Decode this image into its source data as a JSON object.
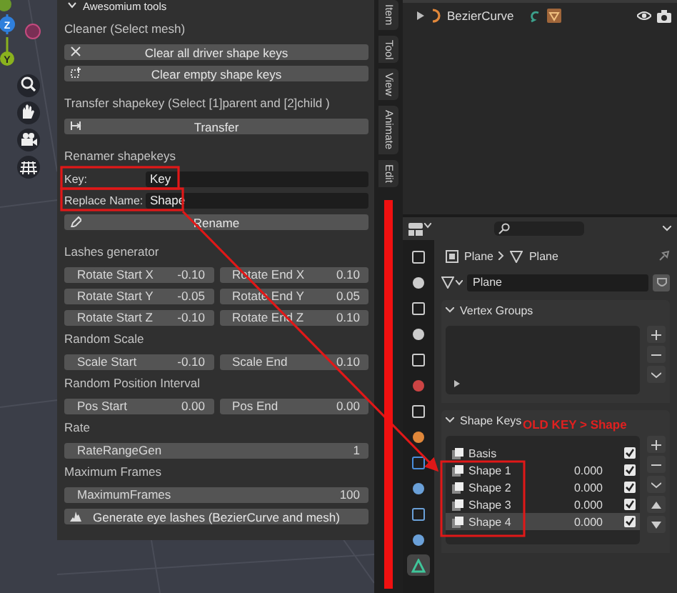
{
  "viewport": {
    "axes": [
      {
        "label": "Z",
        "color": "#2f7fdc"
      },
      {
        "label": "Y",
        "color": "#8ab21e"
      }
    ]
  },
  "tool_panel": {
    "title": "Awesomium tools",
    "sections": [
      {
        "label": "Cleaner (Select mesh)",
        "rows": [
          {
            "kind": "button",
            "label": "Clear all driver shape keys"
          },
          {
            "kind": "button",
            "label": "Clear empty shape keys"
          }
        ]
      },
      {
        "label": "Transfer shapekey (Select [1]parent and [2]child )",
        "rows": [
          {
            "kind": "button",
            "label": "Transfer"
          }
        ]
      },
      {
        "label": "Renamer shapekeys",
        "rows": [
          {
            "kind": "text_field",
            "label": "Key:",
            "value": "Key"
          },
          {
            "kind": "text_field",
            "label": "Replace Name:",
            "value": "Shape"
          },
          {
            "kind": "button",
            "label": "Rename"
          }
        ]
      },
      {
        "label": "Lashes generator",
        "rows": [
          {
            "kind": "number_pair",
            "fields": [
              {
                "label": "Rotate Start X",
                "value": "-0.10"
              },
              {
                "label": "Rotate End X",
                "value": "0.10"
              }
            ]
          },
          {
            "kind": "number_pair",
            "fields": [
              {
                "label": "Rotate Start Y",
                "value": "-0.05"
              },
              {
                "label": "Rotate End Y",
                "value": "0.05"
              }
            ]
          },
          {
            "kind": "number_pair",
            "fields": [
              {
                "label": "Rotate Start Z",
                "value": "-0.10"
              },
              {
                "label": "Rotate End Z",
                "value": "0.10"
              }
            ]
          }
        ]
      },
      {
        "label": "Random Scale",
        "rows": [
          {
            "kind": "number_pair",
            "fields": [
              {
                "label": "Scale Start",
                "value": "-0.10"
              },
              {
                "label": "Scale End",
                "value": "0.10"
              }
            ]
          }
        ]
      },
      {
        "label": "Random Position Interval",
        "rows": [
          {
            "kind": "number_pair",
            "fields": [
              {
                "label": "Pos Start",
                "value": "0.00"
              },
              {
                "label": "Pos End",
                "value": "0.00"
              }
            ]
          }
        ]
      },
      {
        "label": "Rate",
        "rows": [
          {
            "kind": "number",
            "label": "RateRangeGen",
            "value": "1"
          }
        ]
      },
      {
        "label": "Maximum Frames",
        "rows": [
          {
            "kind": "number",
            "label": "MaximumFrames",
            "value": "100"
          },
          {
            "kind": "button",
            "label": "Generate eye lashes (BezierCurve and mesh)"
          }
        ]
      }
    ]
  },
  "sidebar_tabs": [
    {
      "label": "Item"
    },
    {
      "label": "Tool"
    },
    {
      "label": "View"
    },
    {
      "label": "Animate"
    },
    {
      "label": "Edit"
    }
  ],
  "outliner": {
    "rows": [
      {
        "name": "BezierCurve"
      }
    ]
  },
  "properties": {
    "tabs": [
      {
        "selected": false
      },
      {
        "selected": false
      },
      {
        "selected": false
      },
      {
        "selected": false
      },
      {
        "selected": false
      },
      {
        "selected": false
      },
      {
        "selected": false
      },
      {
        "selected": false
      },
      {
        "selected": false
      },
      {
        "selected": false
      },
      {
        "selected": false
      },
      {
        "selected": false
      },
      {
        "selected": true
      }
    ],
    "breadcrumb": [
      "Plane",
      "Plane"
    ],
    "mesh_name": "Plane",
    "vertex_groups": {
      "title": "Vertex Groups"
    },
    "shape_keys": {
      "title": "Shape Keys",
      "keys": [
        {
          "name": "Basis",
          "checked": true,
          "selected": false
        },
        {
          "name": "Shape 1",
          "value": "0.000",
          "checked": true,
          "selected": false
        },
        {
          "name": "Shape 2",
          "value": "0.000",
          "checked": true,
          "selected": false
        },
        {
          "name": "Shape 3",
          "value": "0.000",
          "checked": true,
          "selected": false
        },
        {
          "name": "Shape 4",
          "value": "0.000",
          "checked": true,
          "selected": true
        }
      ]
    }
  },
  "annotation": {
    "note": "OLD KEY > Shape"
  }
}
